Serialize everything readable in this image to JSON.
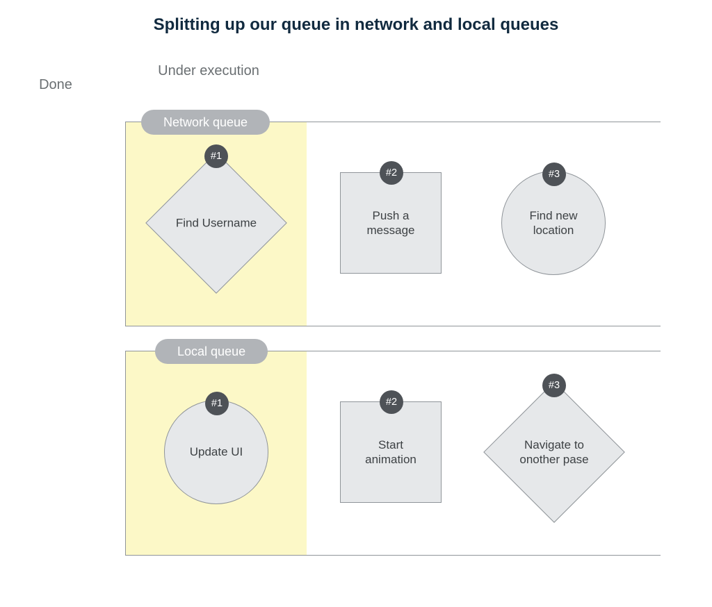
{
  "title": "Splitting up our queue in network and local queues",
  "columns": {
    "done": "Done",
    "under": "Under execution"
  },
  "lanes": {
    "network": {
      "pill": "Network queue",
      "items": [
        {
          "badge": "#1",
          "text": "Find Username"
        },
        {
          "badge": "#2",
          "text": "Push a message"
        },
        {
          "badge": "#3",
          "text": "Find new location"
        }
      ]
    },
    "local": {
      "pill": "Local queue",
      "items": [
        {
          "badge": "#1",
          "text": "Update UI"
        },
        {
          "badge": "#2",
          "text": "Start animation"
        },
        {
          "badge": "#3",
          "text": "Navigate to onother pase"
        }
      ]
    }
  },
  "chart_data": {
    "type": "table",
    "title": "Splitting up our queue in network and local queues",
    "columns": [
      "Done",
      "Under execution",
      "",
      ""
    ],
    "highlight_column_index": 1,
    "rows": [
      {
        "lane": "Network queue",
        "items": [
          {
            "order": 1,
            "shape": "diamond",
            "label": "Find Username",
            "status": "under_execution"
          },
          {
            "order": 2,
            "shape": "square",
            "label": "Push a message",
            "status": "queued"
          },
          {
            "order": 3,
            "shape": "circle",
            "label": "Find new location",
            "status": "queued"
          }
        ]
      },
      {
        "lane": "Local queue",
        "items": [
          {
            "order": 1,
            "shape": "circle",
            "label": "Update UI",
            "status": "under_execution"
          },
          {
            "order": 2,
            "shape": "square",
            "label": "Start animation",
            "status": "queued"
          },
          {
            "order": 3,
            "shape": "diamond",
            "label": "Navigate to onother pase",
            "status": "queued"
          }
        ]
      }
    ]
  }
}
